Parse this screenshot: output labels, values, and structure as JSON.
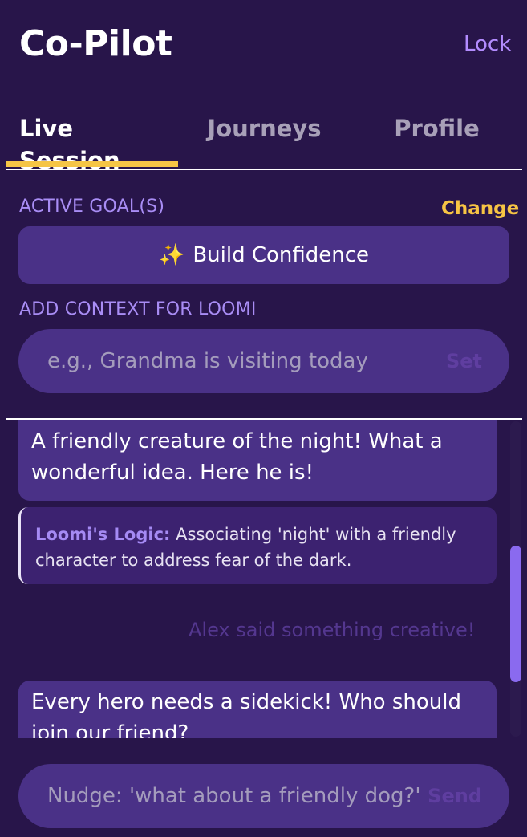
{
  "header": {
    "title": "Co-Pilot",
    "lock_label": "Lock"
  },
  "tabs": [
    {
      "label": "Live Session",
      "active": true
    },
    {
      "label": "Journeys",
      "active": false
    },
    {
      "label": "Profile",
      "active": false
    }
  ],
  "goals": {
    "section_label": "ACTIVE GOAL(S)",
    "change_label": "Change",
    "goal_icon": "✨",
    "goal_label": "Build Confidence"
  },
  "context": {
    "section_label": "ADD CONTEXT FOR LOOMI",
    "placeholder": "e.g., Grandma is visiting today",
    "action_label": "Set"
  },
  "chat": {
    "messages": [
      {
        "text": "A friendly creature of the night! What a wonderful idea. Here he is!"
      },
      {
        "logic_label": "Loomi's Logic:",
        "logic_text": "Associating 'night' with a friendly character to address fear of the dark."
      },
      {
        "system_text": "Alex said something creative!"
      },
      {
        "text": "Every hero needs a sidekick! Who should join our friend?"
      }
    ]
  },
  "nudge": {
    "placeholder": "Nudge: 'what about a friendly dog?'",
    "send_label": "Send"
  },
  "colors": {
    "background": "#28154a",
    "card": "#4a3187",
    "accent_yellow": "#f5c545",
    "accent_purple": "#a98df5"
  }
}
